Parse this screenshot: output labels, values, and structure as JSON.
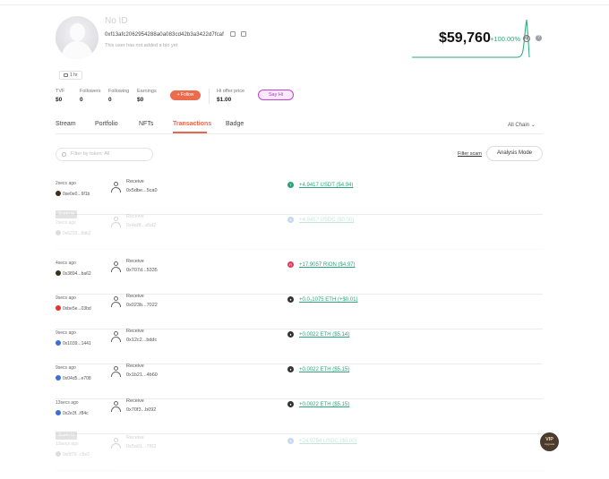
{
  "profile": {
    "name": "No ID",
    "address": "0xf13afc2062954288a0a083cd42b3a3422d7fcaf",
    "bio": "This user has not added a bio yet",
    "tag": "1 hr"
  },
  "balance": {
    "value": "$59,760",
    "change": "+100.00%"
  },
  "stats": {
    "tvf": {
      "label": "TVF",
      "value": "$0"
    },
    "followers": {
      "label": "Followers",
      "value": "0"
    },
    "following": {
      "label": "Following",
      "value": "0"
    },
    "earnings": {
      "label": "Earnings",
      "value": "$0"
    },
    "hi_offer": {
      "label": "Hi offer price",
      "value": "$1.00"
    }
  },
  "buttons": {
    "follow": "Follow",
    "sayhi": "Say Hi",
    "analysis": "Analysis Mode",
    "filter_scam": "Filter scam"
  },
  "tabs": [
    "Stream",
    "Portfolio",
    "NFTs",
    "Transactions",
    "Badge"
  ],
  "chain_select": "All Chain",
  "filter": {
    "placeholder": "Filter by token: All"
  },
  "colors": {
    "accent": "#e8684b",
    "positive": "#2ea77a",
    "sayhi": "#c63fd6"
  },
  "transactions": [
    {
      "time": "2secs ago",
      "hash": "0xe0e0...6f1b",
      "action": "Receive",
      "counterparty": "0x5dbe...5ca0",
      "amount": "+4.9417 USDT ($4.94)",
      "token_icon": "usdt-icon",
      "token_color": "#26a17b",
      "chain_dot": "#3a2f1b"
    },
    {
      "time": "2secs ago",
      "spam": "Scam tx",
      "hash": "0x6232...8db2",
      "action": "Receive",
      "counterparty": "0x4e8f...a5d2",
      "amount": "+4.9417 USDC ($0.00)",
      "token_icon": "usdc-icon",
      "token_color": "#2775ca",
      "chain_dot": "#888888"
    },
    {
      "time": "4secs ago",
      "hash": "0x3894...ba62",
      "action": "Receive",
      "counterparty": "0x707d...5335",
      "amount": "+17.9057 RION ($4.97)",
      "token_icon": "rion-icon",
      "token_color": "#e23a5e",
      "chain_dot": "#3a2f1b"
    },
    {
      "time": "9secs ago",
      "hash": "0xbe5e...03bd",
      "action": "Receive",
      "counterparty": "0x023b...7022",
      "amount": "+0.0₃1075 ETH (+$0.01)",
      "token_icon": "eth-icon",
      "token_color": "#343434",
      "chain_dot": "#e0352d"
    },
    {
      "time": "9secs ago",
      "hash": "0x1039...1441",
      "action": "Receive",
      "counterparty": "0x12c2...bddc",
      "amount": "+0.0022 ETH ($5.14)",
      "token_icon": "eth-icon",
      "token_color": "#343434",
      "chain_dot": "#3b6fd1"
    },
    {
      "time": "9secs ago",
      "hash": "0x04d5...e708",
      "action": "Receive",
      "counterparty": "0x1b21...4b60",
      "amount": "+0.0022 ETH ($5.15)",
      "token_icon": "eth-icon",
      "token_color": "#343434",
      "chain_dot": "#3b6fd1"
    },
    {
      "time": "13secs ago",
      "hash": "0x2e3f...f84c",
      "action": "Receive",
      "counterparty": "0x70f3...b092",
      "amount": "+0.0022 ETH ($5.15)",
      "token_icon": "eth-icon",
      "token_color": "#343434",
      "chain_dot": "#3b6fd1"
    },
    {
      "time": "13secs ago",
      "spam": "Scam tx",
      "hash": "0x0f73...c5e2",
      "action": "Receive",
      "counterparty": "0x5a91...7f02",
      "amount": "+24.9754 USDC ($0.00)",
      "token_icon": "usdc-icon",
      "token_color": "#2775ca",
      "chain_dot": "#888888"
    }
  ],
  "vip": {
    "label": "VIP",
    "sub": "Upgrade"
  }
}
